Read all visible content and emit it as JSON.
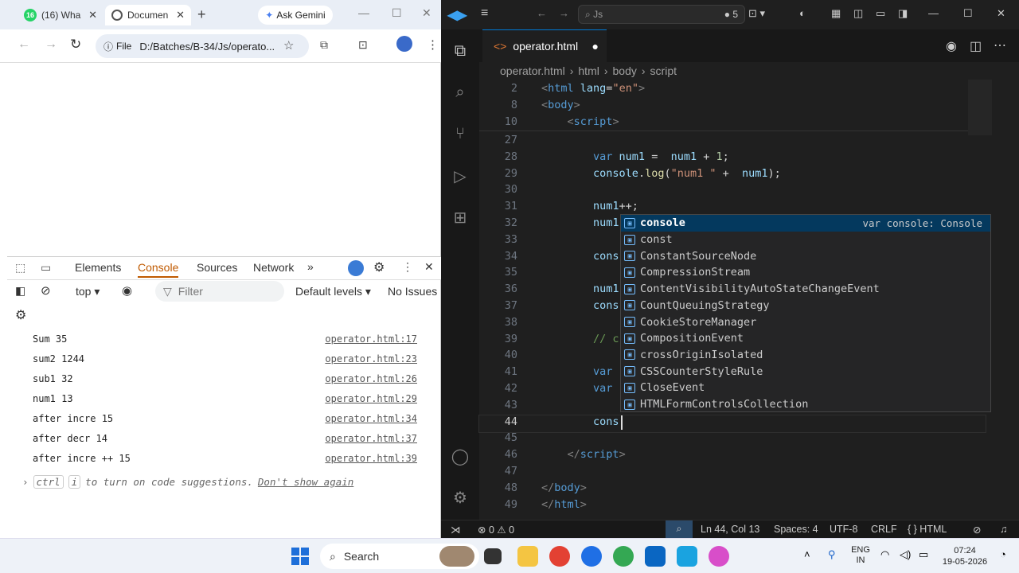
{
  "browser": {
    "tabs": [
      {
        "label": "(16) Wha",
        "badge": "16"
      },
      {
        "label": "Documen"
      }
    ],
    "gemini_label": "Ask Gemini",
    "address": {
      "scheme": "File",
      "url": "D:/Batches/B-34/Js/operato..."
    }
  },
  "devtools": {
    "tabs": [
      "Elements",
      "Console",
      "Sources",
      "Network"
    ],
    "active_tab": "Console",
    "toolbar": {
      "context": "top",
      "filter_placeholder": "Filter",
      "levels": "Default levels",
      "issues": "No Issues"
    },
    "console": [
      {
        "msg": "Sum 35",
        "src": "operator.html:17"
      },
      {
        "msg": "sum2 1244",
        "src": "operator.html:23"
      },
      {
        "msg": "sub1 32",
        "src": "operator.html:26"
      },
      {
        "msg": "num1 13",
        "src": "operator.html:29"
      },
      {
        "msg": "after incre 15",
        "src": "operator.html:34"
      },
      {
        "msg": "after decr 14",
        "src": "operator.html:37"
      },
      {
        "msg": "after incre ++ 15",
        "src": "operator.html:39"
      }
    ],
    "hint": {
      "key1": "ctrl",
      "key2": "i",
      "text": "to turn on code suggestions.",
      "link": "Don't show again"
    }
  },
  "vscode": {
    "search": "Js",
    "badge": "5",
    "tab_label": "operator.html",
    "breadcrumb": [
      "operator.html",
      "html",
      "body",
      "script"
    ],
    "lines": [
      {
        "n": "2",
        "parts": [
          [
            "br",
            "<"
          ],
          [
            "tag",
            "html "
          ],
          [
            "attr",
            "lang"
          ],
          [
            "pl",
            "="
          ],
          [
            "str",
            "\"en\""
          ],
          [
            "br",
            ">"
          ]
        ]
      },
      {
        "n": "8",
        "parts": [
          [
            "br",
            "<"
          ],
          [
            "tag",
            "body"
          ],
          [
            "br",
            ">"
          ]
        ]
      },
      {
        "n": "10",
        "parts": [
          [
            "pl",
            "    "
          ],
          [
            "br",
            "<"
          ],
          [
            "tag",
            "script"
          ],
          [
            "br",
            ">"
          ]
        ]
      },
      {
        "n": "27",
        "parts": []
      },
      {
        "n": "28",
        "parts": [
          [
            "pl",
            "        "
          ],
          [
            "kw",
            "var "
          ],
          [
            "var",
            "num1"
          ],
          [
            "pl",
            " =  "
          ],
          [
            "var",
            "num1"
          ],
          [
            "pl",
            " + "
          ],
          [
            "num",
            "1"
          ],
          [
            "pl",
            ";"
          ]
        ]
      },
      {
        "n": "29",
        "parts": [
          [
            "pl",
            "        "
          ],
          [
            "var",
            "console"
          ],
          [
            "pl",
            "."
          ],
          [
            "fn",
            "log"
          ],
          [
            "pl",
            "("
          ],
          [
            "str",
            "\"num1 \""
          ],
          [
            "pl",
            " +  "
          ],
          [
            "var",
            "num1"
          ],
          [
            "pl",
            ");"
          ]
        ]
      },
      {
        "n": "30",
        "parts": []
      },
      {
        "n": "31",
        "parts": [
          [
            "pl",
            "        "
          ],
          [
            "var",
            "num1"
          ],
          [
            "pl",
            "++;"
          ]
        ]
      },
      {
        "n": "32",
        "parts": [
          [
            "pl",
            "        "
          ],
          [
            "var",
            "num1"
          ]
        ]
      },
      {
        "n": "33",
        "parts": []
      },
      {
        "n": "34",
        "parts": [
          [
            "pl",
            "        "
          ],
          [
            "var",
            "cons"
          ]
        ]
      },
      {
        "n": "35",
        "parts": []
      },
      {
        "n": "36",
        "parts": [
          [
            "pl",
            "        "
          ],
          [
            "var",
            "num1"
          ]
        ]
      },
      {
        "n": "37",
        "parts": [
          [
            "pl",
            "        "
          ],
          [
            "var",
            "cons"
          ]
        ]
      },
      {
        "n": "38",
        "parts": []
      },
      {
        "n": "39",
        "parts": [
          [
            "pl",
            "        "
          ],
          [
            "cm",
            "// c"
          ]
        ]
      },
      {
        "n": "40",
        "parts": []
      },
      {
        "n": "41",
        "parts": [
          [
            "pl",
            "        "
          ],
          [
            "kw",
            "var"
          ]
        ]
      },
      {
        "n": "42",
        "parts": [
          [
            "pl",
            "        "
          ],
          [
            "kw",
            "var"
          ]
        ]
      },
      {
        "n": "43",
        "parts": []
      },
      {
        "n": "44",
        "parts": [
          [
            "pl",
            "        "
          ],
          [
            "var",
            "cons"
          ]
        ]
      },
      {
        "n": "45",
        "parts": []
      },
      {
        "n": "46",
        "parts": [
          [
            "pl",
            "    "
          ],
          [
            "br",
            "</"
          ],
          [
            "tag",
            "script"
          ],
          [
            "br",
            ">"
          ]
        ]
      },
      {
        "n": "47",
        "parts": []
      },
      {
        "n": "48",
        "parts": [
          [
            "br",
            "</"
          ],
          [
            "tag",
            "body"
          ],
          [
            "br",
            ">"
          ]
        ]
      },
      {
        "n": "49",
        "parts": [
          [
            "br",
            "</"
          ],
          [
            "tag",
            "html"
          ],
          [
            "br",
            ">"
          ]
        ]
      }
    ],
    "current_line": "44",
    "suggestions": [
      {
        "label": "console",
        "detail": "var console: Console"
      },
      {
        "label": "const"
      },
      {
        "label": "ConstantSourceNode"
      },
      {
        "label": "CompressionStream"
      },
      {
        "label": "ContentVisibilityAutoStateChangeEvent"
      },
      {
        "label": "CountQueuingStrategy"
      },
      {
        "label": "CookieStoreManager"
      },
      {
        "label": "CompositionEvent"
      },
      {
        "label": "crossOriginIsolated"
      },
      {
        "label": "CSSCounterStyleRule"
      },
      {
        "label": "CloseEvent"
      },
      {
        "label": "HTMLFormControlsCollection"
      }
    ],
    "status": {
      "errors": "0",
      "warnings": "0",
      "position": "Ln 44, Col 13",
      "spaces": "Spaces: 4",
      "encoding": "UTF-8",
      "eol": "CRLF",
      "language": "HTML"
    }
  },
  "taskbar": {
    "search": "Search",
    "lang1": "ENG",
    "lang2": "IN",
    "time": "07:24",
    "date": "19-05-2026"
  }
}
